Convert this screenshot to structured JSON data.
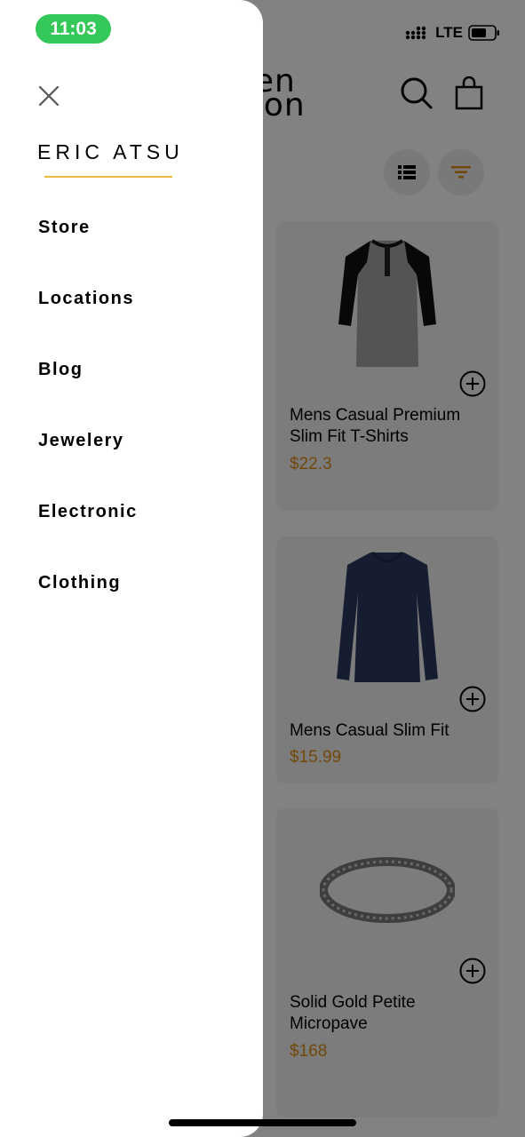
{
  "status_bar": {
    "time": "11:03",
    "network": "LTE"
  },
  "app": {
    "logo_line1": "pen",
    "logo_line2": "nion",
    "products": [
      {
        "name": "Mens Casual Premium Slim Fit T-Shirts",
        "price": "$22.3"
      },
      {
        "name": "Mens Casual Slim Fit",
        "price": "$15.99"
      },
      {
        "name": "Solid Gold Petite Micropave",
        "price": "$168"
      }
    ]
  },
  "drawer": {
    "user_name": "ERIC ATSU",
    "menu": [
      "Store",
      "Locations",
      "Blog",
      "Jewelery",
      "Electronic",
      "Clothing"
    ]
  },
  "colors": {
    "accent_underline": "#e6b93a",
    "price": "#e08e14",
    "time_pill": "#34c759"
  }
}
